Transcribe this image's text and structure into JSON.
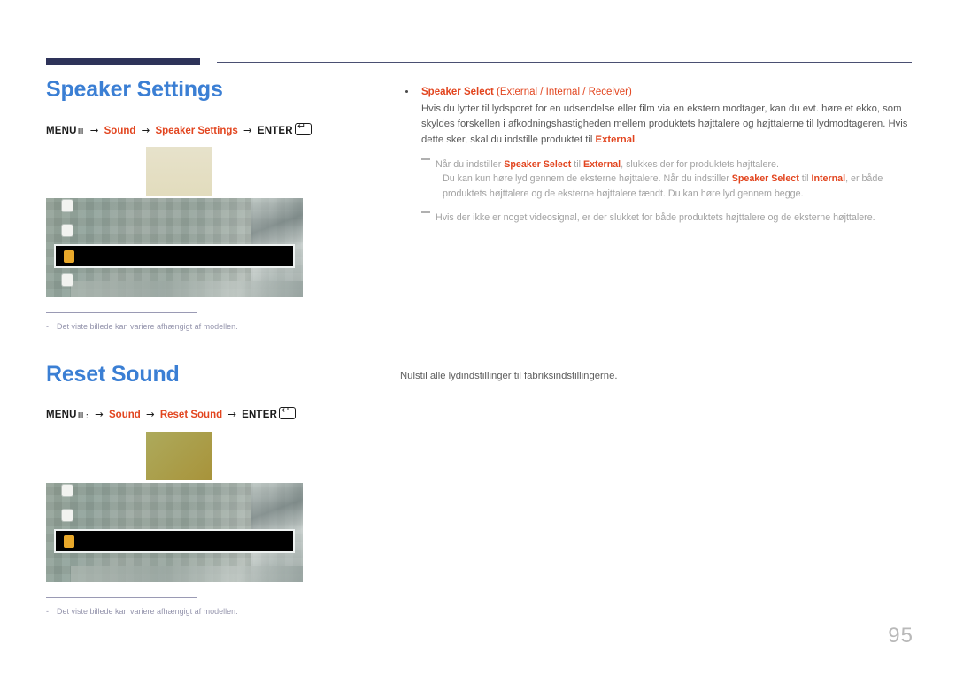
{
  "page": {
    "number": "95"
  },
  "sections": [
    {
      "id": "speaker-settings",
      "title": "Speaker Settings",
      "menu_path": {
        "menu_label": "MENU",
        "menu_glyph": "Ⅲ",
        "arrow": "→",
        "steps": [
          "Sound",
          "Speaker Settings"
        ],
        "enter_label": "ENTER",
        "enter_icon": "enter-key-icon"
      },
      "figure": {
        "swatch_style": "beige",
        "highlight_icon": "speaker-icon",
        "note_dash": "-",
        "note": "Det viste billede kan variere afhængigt af modellen."
      }
    },
    {
      "id": "reset-sound",
      "title": "Reset Sound",
      "menu_path": {
        "menu_label": "MENU",
        "menu_glyph": "Ⅲ",
        "separator": ":",
        "arrow": "→",
        "steps": [
          "Sound",
          "Reset Sound"
        ],
        "enter_label": "ENTER",
        "enter_icon": "enter-key-icon"
      },
      "figure": {
        "swatch_style": "gold",
        "highlight_icon": "reset-icon",
        "note_dash": "-",
        "note": "Det viste billede kan variere afhængigt af modellen."
      }
    }
  ],
  "right_column": {
    "bullet": {
      "title_main": "Speaker Select",
      "title_options": " (External / Internal / Receiver)",
      "body_1": "Hvis du lytter til lydsporet for en udsendelse eller film via en ekstern modtager, kan du evt. høre et ekko, som skyldes forskellen i afkodningshastigheden mellem produktets højttalere og højttalerne til lydmodtageren. Hvis dette sker, skal du indstille produktet til ",
      "body_1_bold": "External",
      "body_1_end": "."
    },
    "notes": [
      {
        "line_1_a": "Når du indstiller ",
        "line_1_b": "Speaker Select",
        "line_1_c": " til ",
        "line_1_d": "External",
        "line_1_e": ", slukkes der for produktets højttalere.",
        "line_2_a": "Du kan kun høre lyd gennem de eksterne højttalere. Når du indstiller ",
        "line_2_b": "Speaker Select",
        "line_2_c": " til ",
        "line_2_d": "Internal",
        "line_2_e": ", er både produktets højttalere og de eksterne højttalere tændt. Du kan høre lyd gennem begge."
      },
      {
        "line_1_a": "Hvis der ikke er noget videosignal, er der slukket for både produktets højttalere og de eksterne højttalere."
      }
    ],
    "reset_description": "Nulstil alle lydindstillinger til fabriksindstillingerne."
  },
  "colors": {
    "heading_blue": "#3b7fd4",
    "accent_red": "#e2451f",
    "rule_navy": "#2e3359",
    "note_gray": "#9595ad",
    "body_gray": "#585858"
  }
}
